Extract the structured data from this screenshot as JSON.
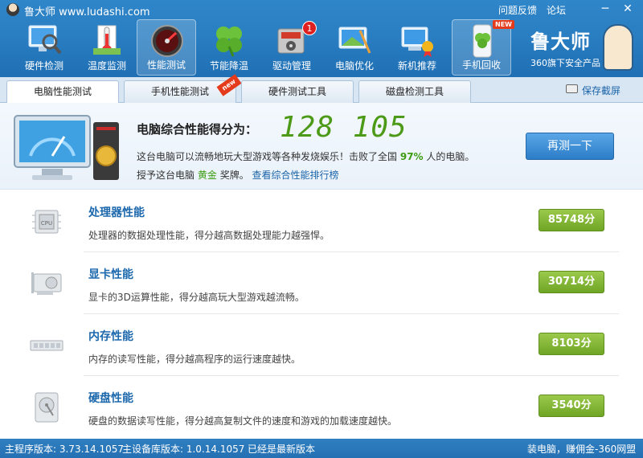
{
  "app": {
    "title": "鲁大师 www.ludashi.com",
    "feedback": "问题反馈",
    "forum": "论坛"
  },
  "window_controls": {
    "minimize": "─",
    "close": "✕"
  },
  "toolbar": {
    "items": [
      {
        "label": "硬件检测",
        "icon": "hardware-check-icon"
      },
      {
        "label": "温度监测",
        "icon": "thermometer-icon"
      },
      {
        "label": "性能测试",
        "icon": "speedometer-icon"
      },
      {
        "label": "节能降温",
        "icon": "clover-icon"
      },
      {
        "label": "驱动管理",
        "icon": "driver-gear-icon",
        "badge": "1"
      },
      {
        "label": "电脑优化",
        "icon": "monitor-broom-icon"
      },
      {
        "label": "新机推荐",
        "icon": "new-pc-icon"
      },
      {
        "label": "手机回收",
        "icon": "phone-recycle-icon",
        "badge": "NEW"
      }
    ],
    "active_index": 2
  },
  "brand": {
    "name": "鲁大师",
    "sub": "360旗下安全产品"
  },
  "tabs": [
    {
      "label": "电脑性能测试"
    },
    {
      "label": "手机性能测试",
      "badge": "new"
    },
    {
      "label": "硬件测试工具"
    },
    {
      "label": "磁盘检测工具"
    }
  ],
  "screenshot": {
    "label": "保存截屏"
  },
  "summary": {
    "title": "电脑综合性能得分为：",
    "score": "128 105",
    "desc_pre": "这台电脑可以流畅地玩大型游戏等各种发烧娱乐！击败了全国",
    "percent": "97%",
    "desc_post": "人的电脑。",
    "award_pre": "授予这台电脑",
    "award_level": "黄金",
    "award_post": "奖牌。",
    "rank_link": "查看综合性能排行榜",
    "retest": "再测一下"
  },
  "items": [
    {
      "title": "处理器性能",
      "desc": "处理器的数据处理性能，得分越高数据处理能力越强悍。",
      "score": "85748分",
      "icon": "cpu-icon"
    },
    {
      "title": "显卡性能",
      "desc": "显卡的3D运算性能，得分越高玩大型游戏越流畅。",
      "score": "30714分",
      "icon": "graphics-card-icon"
    },
    {
      "title": "内存性能",
      "desc": "内存的读写性能，得分越高程序的运行速度越快。",
      "score": "8103分",
      "icon": "memory-icon"
    },
    {
      "title": "硬盘性能",
      "desc": "硬盘的数据读写性能，得分越高复制文件的速度和游戏的加载速度越快。",
      "score": "3540分",
      "icon": "hard-disk-icon"
    }
  ],
  "status": {
    "program_version": "主程序版本: 3.73.14.1057",
    "db_version": "主设备库版本: 1.0.14.1057",
    "latest": "已经是最新版本",
    "promo": "装电脑，赚佣金-360网盟"
  },
  "colors": {
    "accent_blue": "#2a7ec2",
    "score_green": "#4c9a18",
    "badge_green": "#7fb332",
    "link_blue": "#1b64a8"
  }
}
